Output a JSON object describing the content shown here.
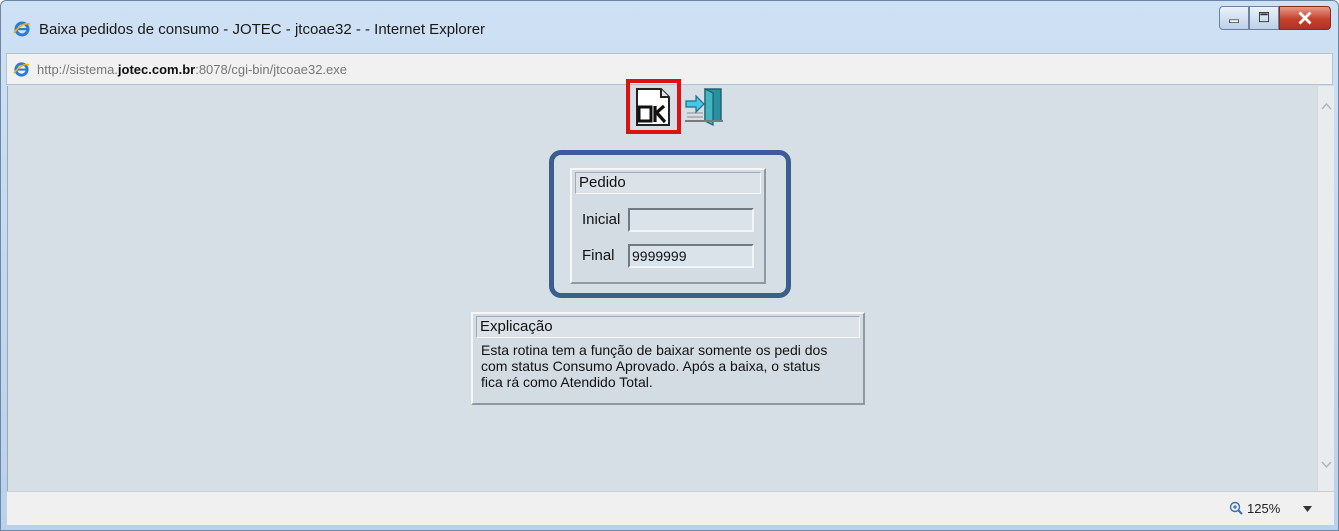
{
  "window": {
    "title": "Baixa pedidos de consumo - JOTEC - jtcoae32 - - Internet Explorer",
    "controls": {
      "minimize": "minimize",
      "maximize": "maximize",
      "close": "close"
    }
  },
  "address": {
    "prefix": "http://sistema.",
    "domain": "jotec.com.br",
    "suffix": ":8078/cgi-bin/jtcoae32.exe"
  },
  "toolbar": {
    "ok_icon": "ok-icon",
    "exit_icon": "exit-door-icon",
    "highlight_color": "#e01010"
  },
  "pedido": {
    "title": "Pedido",
    "inicial_label": "Inicial",
    "inicial_value": "",
    "final_label": "Final",
    "final_value": "9999999",
    "frame_color": "#3b5d8f"
  },
  "explicacao": {
    "title": "Explicação",
    "line1": "Esta rotina tem a função de baixar somente os pedi dos",
    "line2": "com status Consumo Aprovado. Após a baixa, o status",
    "line3": "fica rá como Atendido Total."
  },
  "status": {
    "zoom": "125%"
  }
}
